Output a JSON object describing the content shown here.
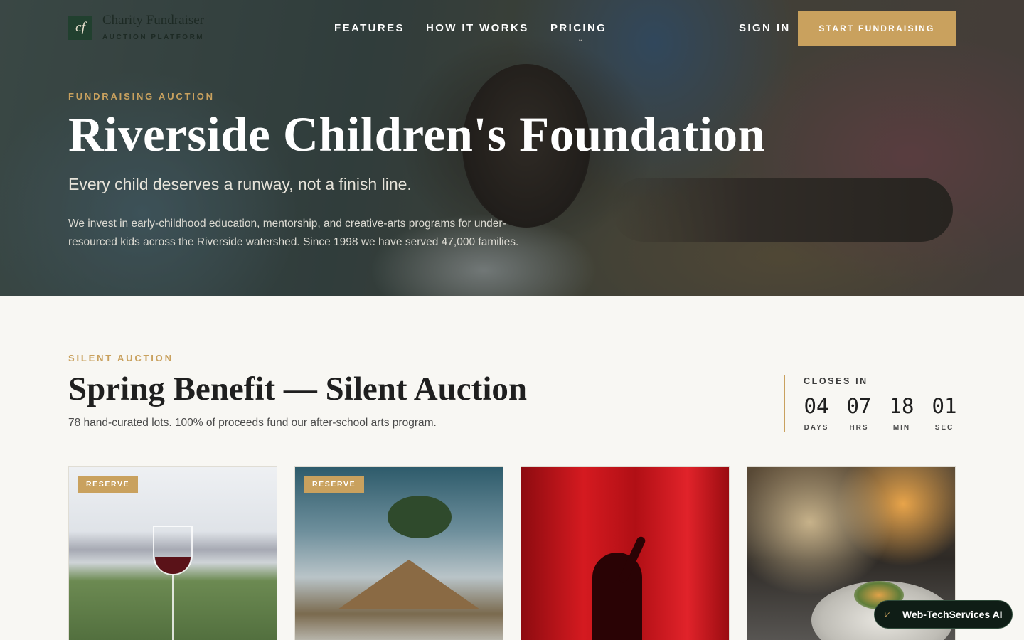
{
  "brand": {
    "logo_mark": "cf",
    "name": "Charity Fundraiser",
    "tagline": "AUCTION PLATFORM"
  },
  "nav": {
    "links": [
      "FEATURES",
      "HOW IT WORKS",
      "PRICING"
    ],
    "sign_in": "SIGN IN",
    "cta": "START FUNDRAISING"
  },
  "hero": {
    "eyebrow": "FUNDRAISING AUCTION",
    "title": "Riverside Children's Foundation",
    "subtitle": "Every child deserves a runway, not a finish line.",
    "description": "We invest in early-childhood education, mentorship, and creative-arts programs for under-resourced kids across the Riverside watershed. Since 1998 we have served 47,000 families."
  },
  "auction": {
    "eyebrow": "SILENT AUCTION",
    "title": "Spring Benefit — Silent Auction",
    "description": "78 hand-curated lots. 100% of proceeds fund our after-school arts program.",
    "countdown": {
      "label": "CLOSES IN",
      "units": [
        {
          "value": "04",
          "label": "DAYS"
        },
        {
          "value": "07",
          "label": "HRS"
        },
        {
          "value": "18",
          "label": "MIN"
        },
        {
          "value": "01",
          "label": "SEC"
        }
      ]
    },
    "lots": [
      {
        "badge": "RESERVE",
        "image": "vineyard-wine-glass"
      },
      {
        "badge": "RESERVE",
        "image": "tropical-beach-hut"
      },
      {
        "badge": "",
        "image": "theater-curtain-silhouette"
      },
      {
        "badge": "",
        "image": "fine-dining-plate"
      }
    ]
  },
  "assistant": {
    "label": "Web-TechServices AI",
    "icon": "chevron-check-icon"
  },
  "colors": {
    "accent": "#c9a15e",
    "logo_green": "#21402f",
    "background": "#f8f7f3"
  }
}
